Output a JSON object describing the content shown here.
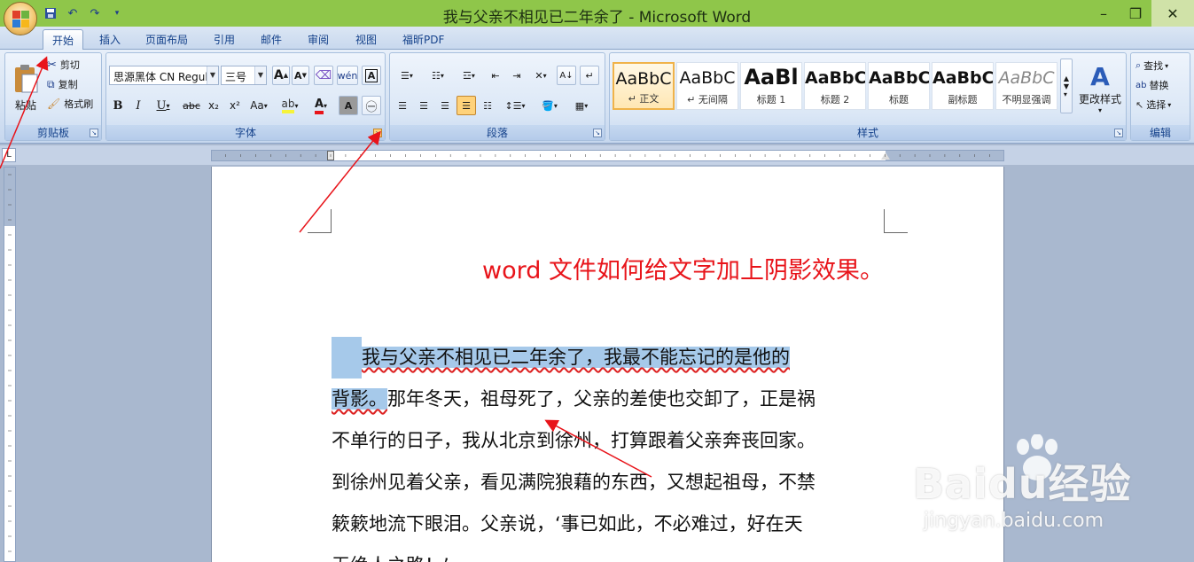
{
  "window": {
    "title": "我与父亲不相见已二年余了 - Microsoft Word"
  },
  "quick_access": {
    "save_icon": "save-icon",
    "undo_icon": "undo-icon",
    "redo_icon": "redo-icon"
  },
  "tabs": [
    "开始",
    "插入",
    "页面布局",
    "引用",
    "邮件",
    "审阅",
    "视图",
    "福昕PDF"
  ],
  "clipboard": {
    "paste": "粘贴",
    "cut": "剪切",
    "copy": "复制",
    "format_painter": "格式刷",
    "label": "剪贴板"
  },
  "font_group": {
    "font_name": "思源黑体 CN Regul",
    "font_size": "三号",
    "label": "字体",
    "bold": "B",
    "italic": "I",
    "underline": "U",
    "strike": "abc",
    "subscript": "x₂",
    "superscript": "x²",
    "change_case": "Aa",
    "grow": "A",
    "shrink": "A",
    "font_color_accent": "#e8141a"
  },
  "paragraph_group": {
    "label": "段落"
  },
  "styles_group": {
    "label": "样式",
    "tiles": [
      {
        "sample": "AaBbC",
        "name": "↵ 正文"
      },
      {
        "sample": "AaBbC",
        "name": "↵ 无间隔"
      },
      {
        "sample": "AaBl",
        "name": "标题 1"
      },
      {
        "sample": "AaBbC",
        "name": "标题 2"
      },
      {
        "sample": "AaBbC",
        "name": "标题"
      },
      {
        "sample": "AaBbC",
        "name": "副标题"
      },
      {
        "sample": "AaBbC",
        "name": "不明显强调"
      }
    ],
    "change_styles": "更改样式"
  },
  "editing_group": {
    "label": "编辑",
    "find": "查找",
    "replace": "替换",
    "select": "选择"
  },
  "document": {
    "title_text": "word 文件如何给文字加上阴影效果。",
    "paragraph_lines": [
      {
        "sel": "我与父亲不相见已二年余了，我最不能忘记的是他的",
        "rest": ""
      },
      {
        "sel": "背影。",
        "rest": "那年冬天，祖母死了，父亲的差使也交卸了，正是祸"
      },
      {
        "sel": "",
        "rest": "不单行的日子，我从北京到徐州，打算跟着父亲奔丧回家。"
      },
      {
        "sel": "",
        "rest": "到徐州见着父亲，看见满院狼藉的东西，又想起祖母，不禁"
      },
      {
        "sel": "",
        "rest": "簌簌地流下眼泪。父亲说，‘事已如此，不必难过，好在天"
      },
      {
        "sel": "",
        "rest": "无绝人之路！’"
      }
    ]
  },
  "watermark": {
    "big": "Baidu经验",
    "small": "jingyan.baidu.com"
  },
  "annotation_color": "#e8141a"
}
